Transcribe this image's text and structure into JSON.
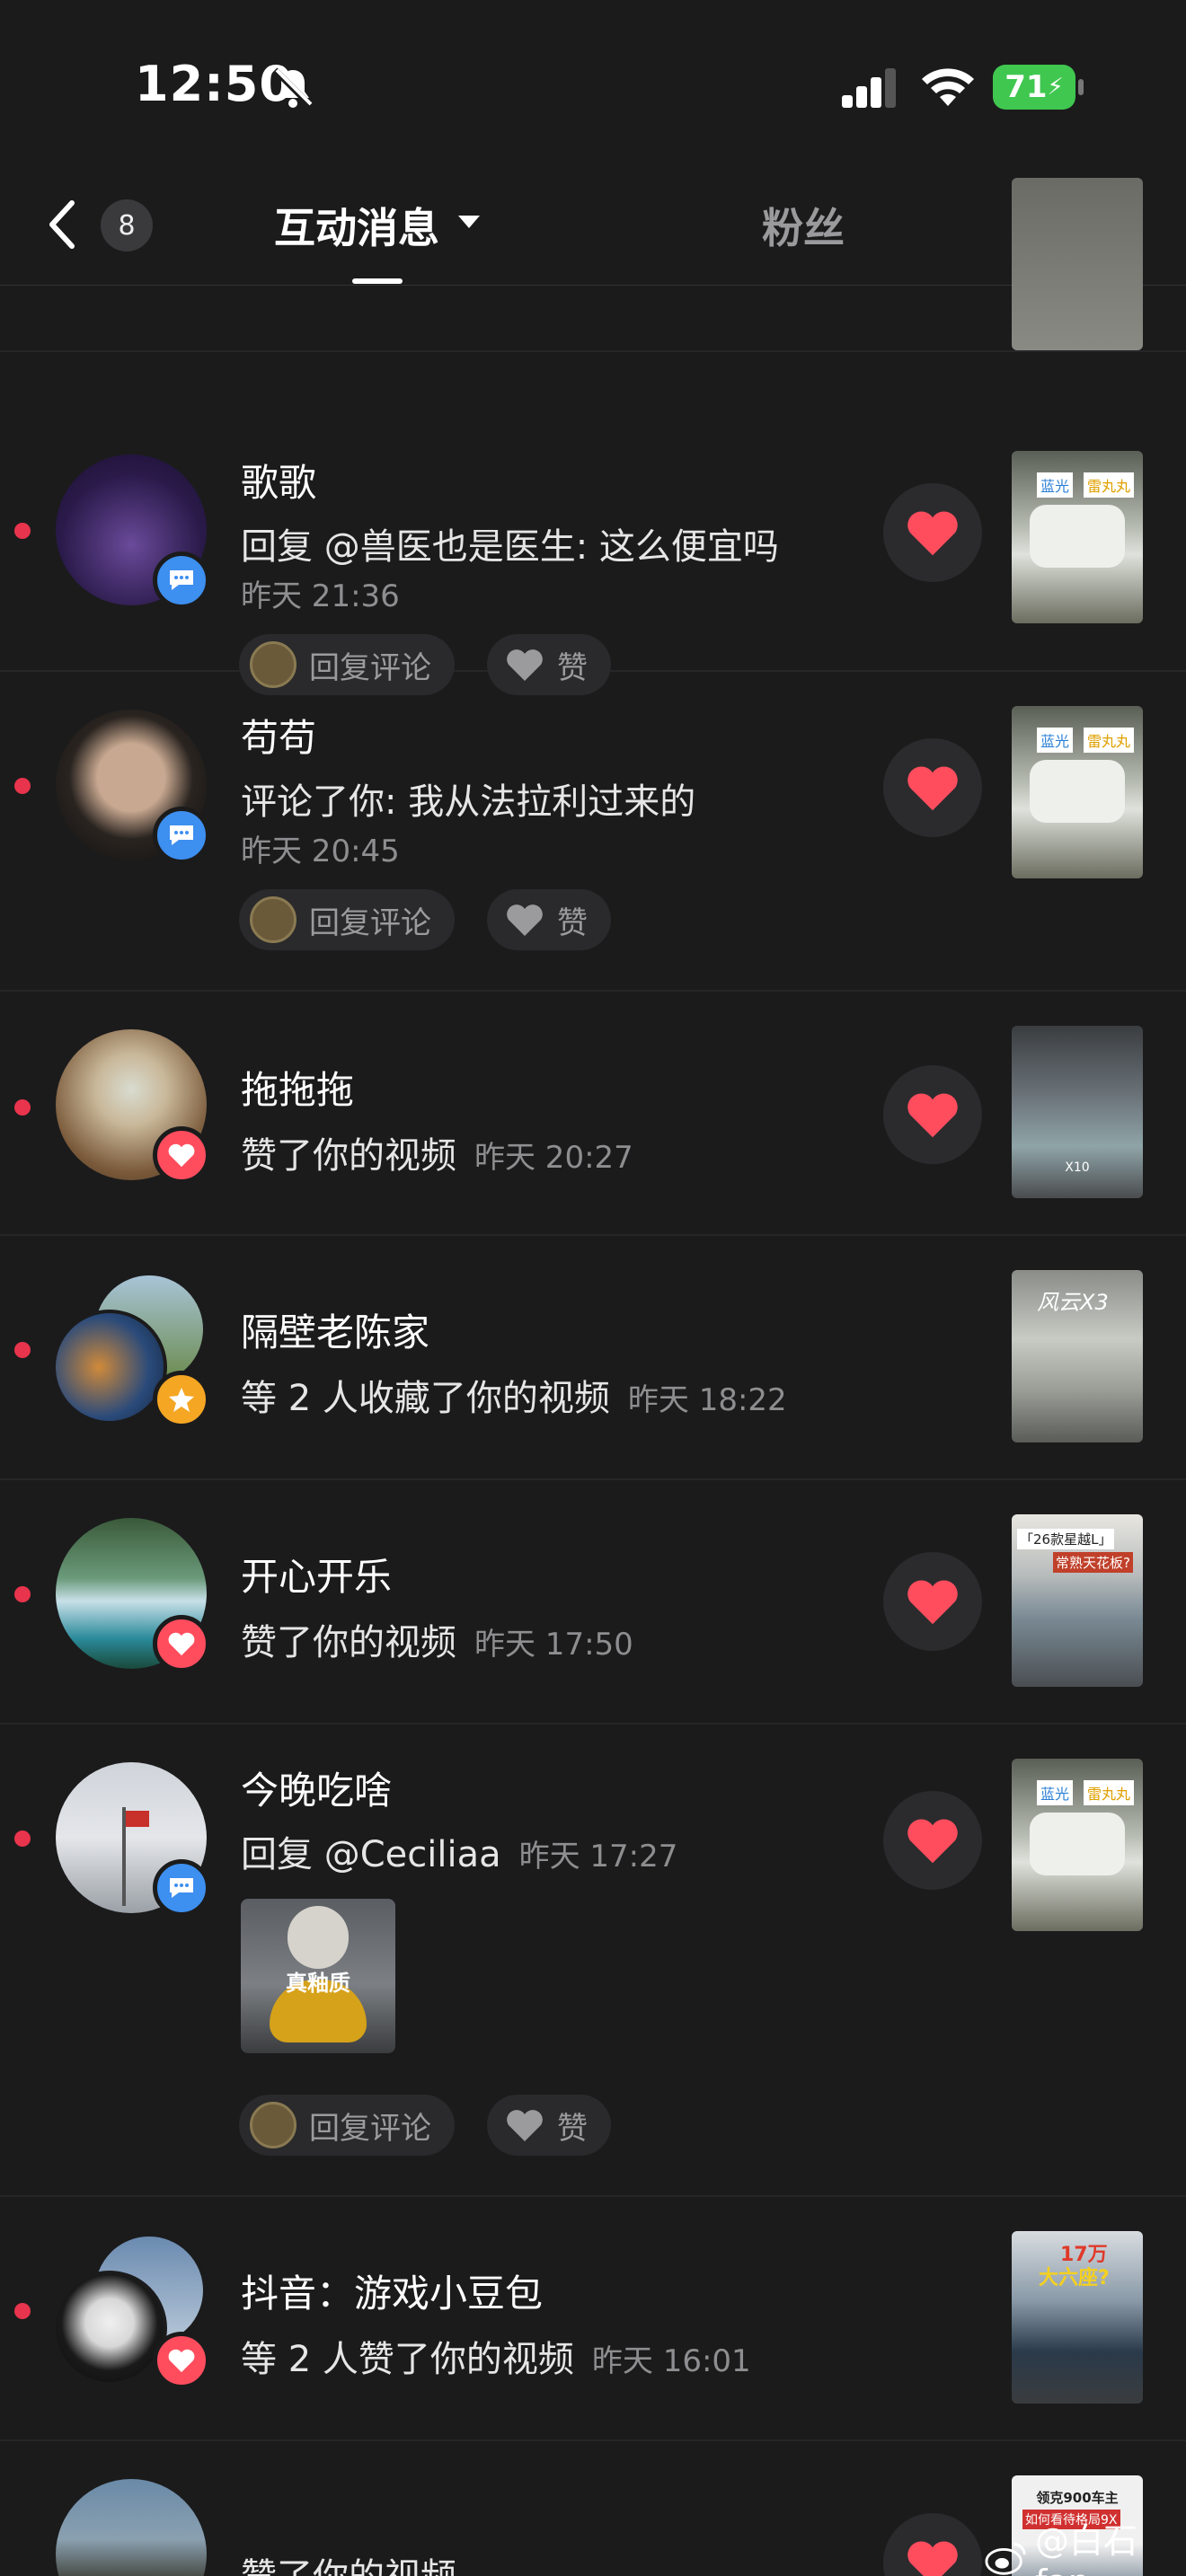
{
  "status": {
    "time": "12:50",
    "battery": "71"
  },
  "nav": {
    "back_count": "8",
    "tab_active": "互动消息",
    "tab_other": "粉丝"
  },
  "actions": {
    "reply_label": "回复评论",
    "like_label": "赞"
  },
  "rows": [
    {
      "name": "歌歌",
      "text": "回复 @兽医也是医生: 这么便宜吗",
      "time": "昨天 21:36",
      "thumb_tags": [
        "蓝光",
        "雷丸丸"
      ]
    },
    {
      "name": "苟苟",
      "text": "评论了你: 我从法拉利过来的",
      "time": "昨天 20:45",
      "thumb_tags": [
        "蓝光",
        "雷丸丸"
      ]
    },
    {
      "name": "拖拖拖",
      "text": "赞了你的视频",
      "time": "昨天 20:27",
      "thumb_text": "X10"
    },
    {
      "name": "隔壁老陈家",
      "text": "等 2 人收藏了你的视频",
      "time": "昨天 18:22",
      "thumb_text": "风云X3"
    },
    {
      "name": "开心开乐",
      "text": "赞了你的视频",
      "time": "昨天 17:50",
      "thumb_text": "「26款星越L」",
      "thumb_text2": "常熟天花板?"
    },
    {
      "name": "今晚吃啥",
      "text": "回复 @Ceciliaa",
      "time": "昨天 17:27",
      "sticker_text": "真釉质",
      "thumb_tags": [
        "蓝光",
        "雷丸丸"
      ]
    },
    {
      "name": "抖音：游戏小豆包",
      "text": "等 2 人赞了你的视频",
      "time": "昨天 16:01",
      "thumb_text": "17万",
      "thumb_text2": "大六座?"
    },
    {
      "name": "",
      "text": "赞了你的视频",
      "time": "",
      "thumb_text": "领克900车主",
      "thumb_text2": "如何看待格局9X"
    }
  ],
  "watermark": "@白石fan",
  "colors": {
    "bg": "#1b1b1c",
    "unread_dot": "#e8344c",
    "heart": "#ff4d5e",
    "comment_badge": "#3d8ff0",
    "star_badge": "#f5a623"
  }
}
